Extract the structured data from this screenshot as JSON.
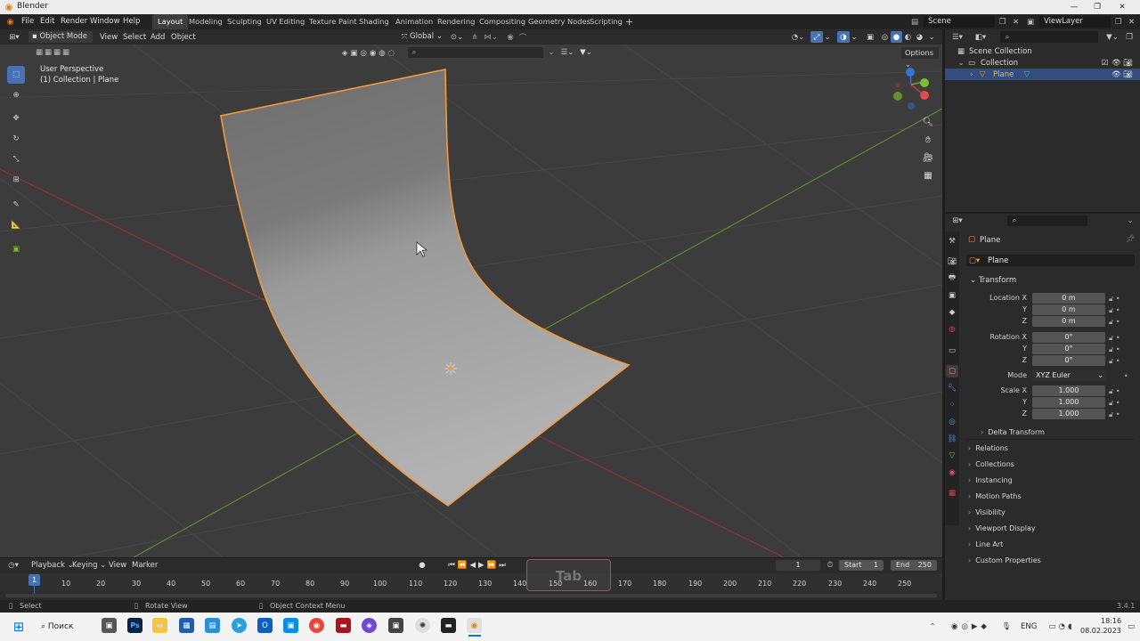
{
  "window": {
    "title": "Blender"
  },
  "menu": [
    "File",
    "Edit",
    "Render",
    "Window",
    "Help"
  ],
  "workspaces": [
    "Layout",
    "Modeling",
    "Sculpting",
    "UV Editing",
    "Texture Paint",
    "Shading",
    "Animation",
    "Rendering",
    "Compositing",
    "Geometry Nodes",
    "Scripting"
  ],
  "workspace_add": "+",
  "scene_name": "Scene",
  "view_layer": "ViewLayer",
  "viewport_header": {
    "mode": "Object Mode",
    "view": "View",
    "select": "Select",
    "add": "Add",
    "object": "Object",
    "orientation": "Global",
    "options": "Options"
  },
  "viewport": {
    "overlay_line1": "User Perspective",
    "overlay_line2": "(1) Collection | Plane"
  },
  "outliner": {
    "root": "Scene Collection",
    "collection": "Collection",
    "object": "Plane"
  },
  "properties": {
    "object_name": "Plane",
    "data_name": "Plane",
    "transform": "Transform",
    "location_label": "Location X",
    "loc": [
      "0 m",
      "0 m",
      "0 m"
    ],
    "rotation_label": "Rotation X",
    "rot": [
      "0°",
      "0°",
      "0°"
    ],
    "mode_label": "Mode",
    "mode_value": "XYZ Euler",
    "scale_label": "Scale X",
    "scale": [
      "1.000",
      "1.000",
      "1.000"
    ],
    "y": "Y",
    "z": "Z",
    "delta": "Delta Transform",
    "sections": [
      "Relations",
      "Collections",
      "Instancing",
      "Motion Paths",
      "Visibility",
      "Viewport Display",
      "Line Art",
      "Custom Properties"
    ]
  },
  "timeline": {
    "playback": "Playback",
    "keying": "Keying",
    "view": "View",
    "marker": "Marker",
    "current_frame": "1",
    "start_label": "Start",
    "start": "1",
    "end_label": "End",
    "end": "250",
    "ticks": [
      "10",
      "20",
      "30",
      "40",
      "50",
      "60",
      "70",
      "80",
      "90",
      "100",
      "110",
      "120",
      "130",
      "140",
      "150",
      "160",
      "170",
      "180",
      "190",
      "200",
      "210",
      "220",
      "230",
      "240",
      "250"
    ],
    "key_overlay": "Tab"
  },
  "status": {
    "select": "Select",
    "rotate": "Rotate View",
    "context": "Object Context Menu",
    "version": "3.4.1"
  },
  "taskbar": {
    "search": "Поиск",
    "lang": "ENG",
    "time": "18:16",
    "date": "08.02.2023"
  },
  "colors": {
    "accent": "#4772b3",
    "selection_outline": "#f29a3c",
    "axis_x": "#c43c3c",
    "axis_y": "#6fa12f",
    "grid_bg": "#3c3c3c"
  }
}
